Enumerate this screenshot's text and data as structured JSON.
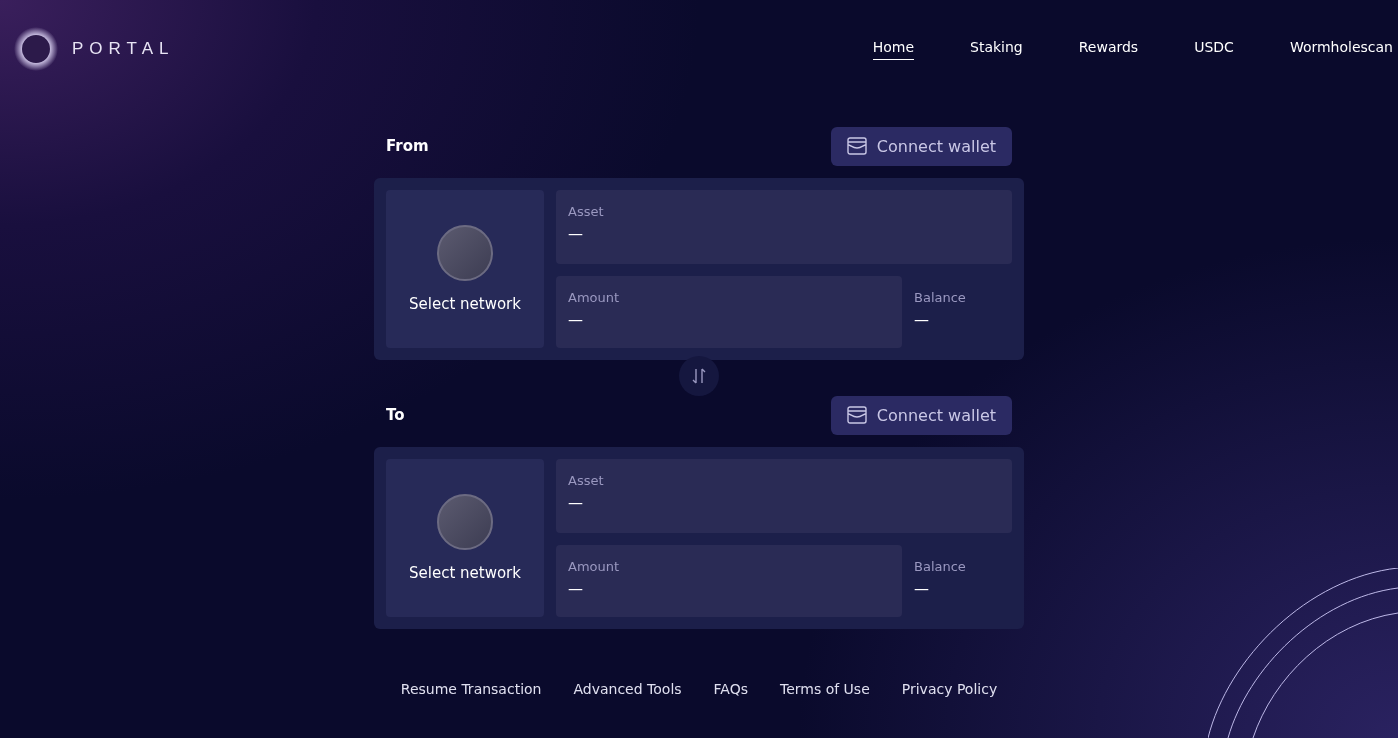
{
  "logo": {
    "text": "PORTAL"
  },
  "nav": [
    {
      "label": "Home",
      "selected": true
    },
    {
      "label": "Staking",
      "selected": false
    },
    {
      "label": "Rewards",
      "selected": false
    },
    {
      "label": "USDC",
      "selected": false
    },
    {
      "label": "Wormholescan",
      "selected": false
    }
  ],
  "sections": [
    {
      "title": "From",
      "connect_button": "Connect wallet",
      "network_label": "Select network",
      "asset": {
        "label": "Asset",
        "value": "—"
      },
      "amount": {
        "label": "Amount",
        "value": "—"
      },
      "balance": {
        "label": "Balance",
        "value": "—"
      }
    },
    {
      "title": "To",
      "connect_button": "Connect wallet",
      "network_label": "Select network",
      "asset": {
        "label": "Asset",
        "value": "—"
      },
      "amount": {
        "label": "Amount",
        "value": "—"
      },
      "balance": {
        "label": "Balance",
        "value": "—"
      }
    }
  ],
  "footer_links": [
    "Resume Transaction",
    "Advanced Tools",
    "FAQs",
    "Terms of Use",
    "Privacy Policy"
  ]
}
